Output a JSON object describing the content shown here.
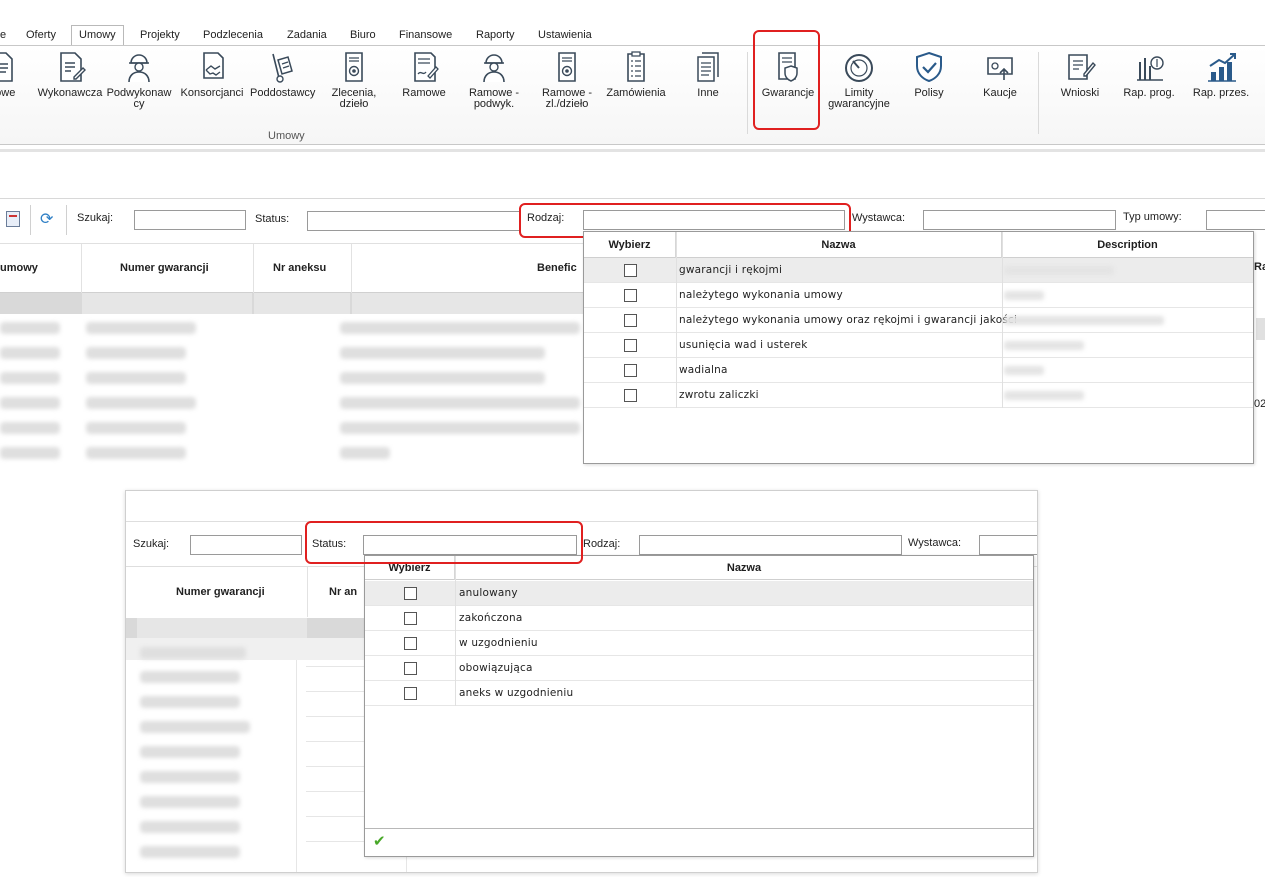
{
  "ribbon": {
    "tabs": [
      {
        "label": "e",
        "active": false
      },
      {
        "label": "Oferty",
        "active": false
      },
      {
        "label": "Umowy",
        "active": true
      },
      {
        "label": "Projekty",
        "active": false
      },
      {
        "label": "Podzlecenia",
        "active": false
      },
      {
        "label": "Zadania",
        "active": false
      },
      {
        "label": "Biuro",
        "active": false
      },
      {
        "label": "Finansowe",
        "active": false
      },
      {
        "label": "Raporty",
        "active": false
      },
      {
        "label": "Ustawienia",
        "active": false
      }
    ],
    "buttons": [
      {
        "label1": "ktowe",
        "label2": "",
        "icon": "document-icon"
      },
      {
        "label1": "Wykonawcza",
        "label2": "",
        "icon": "contract-pen-icon"
      },
      {
        "label1": "Podwykonaw",
        "label2": "cy",
        "icon": "worker-icon"
      },
      {
        "label1": "Konsorcjanci",
        "label2": "",
        "icon": "handshake-icon"
      },
      {
        "label1": "Poddostawcy",
        "label2": "",
        "icon": "hand-truck-icon"
      },
      {
        "label1": "Zlecenia,",
        "label2": "dzieło",
        "icon": "certificate-icon"
      },
      {
        "label1": "Ramowe",
        "label2": "",
        "icon": "document-sign-icon"
      },
      {
        "label1": "Ramowe -",
        "label2": "podwyk.",
        "icon": "worker-icon"
      },
      {
        "label1": "Ramowe -",
        "label2": "zl./dzieło",
        "icon": "certificate-icon"
      },
      {
        "label1": "Zamówienia",
        "label2": "",
        "icon": "checklist-icon"
      },
      {
        "label1": "Inne",
        "label2": "",
        "icon": "documents-stack-icon"
      },
      {
        "label1": "Gwarancje",
        "label2": "",
        "icon": "guarantee-shield-icon"
      },
      {
        "label1": "Limity",
        "label2": "gwarancyjne",
        "icon": "gauge-icon"
      },
      {
        "label1": "Polisy",
        "label2": "",
        "icon": "shield-check-icon"
      },
      {
        "label1": "Kaucje",
        "label2": "",
        "icon": "deposit-icon"
      },
      {
        "label1": "Wnioski",
        "label2": "",
        "icon": "edit-document-icon"
      },
      {
        "label1": "Rap. prog.",
        "label2": "",
        "icon": "report-money-icon"
      },
      {
        "label1": "Rap. przes.",
        "label2": "",
        "icon": "chart-growth-icon"
      }
    ],
    "group_label": "Umowy"
  },
  "panel1": {
    "search_label": "Szukaj:",
    "status_label": "Status:",
    "rodzaj_label": "Rodzaj:",
    "wystawca_label": "Wystawca:",
    "typ_umowy_label": "Typ umowy:",
    "columns": [
      "umowy",
      "Numer gwarancji",
      "Nr aneksu",
      "Benefic"
    ],
    "right_cut_header": "Ra",
    "right_cut_value": "02",
    "dropdown": {
      "col_select": "Wybierz",
      "col_name": "Nazwa",
      "col_desc": "Description",
      "rows": [
        {
          "name": "gwarancji i rękojmi"
        },
        {
          "name": "należytego wykonania umowy"
        },
        {
          "name": "należytego wykonania umowy oraz rękojmi i gwarancji jakości"
        },
        {
          "name": "usunięcia wad i usterek"
        },
        {
          "name": "wadialna"
        },
        {
          "name": "zwrotu zaliczki"
        }
      ]
    }
  },
  "panel2": {
    "search_label": "Szukaj:",
    "status_label": "Status:",
    "rodzaj_label": "Rodzaj:",
    "wystawca_label": "Wystawca:",
    "col_numer": "Numer gwarancji",
    "col_nr_cut": "Nr an",
    "dropdown": {
      "col_select": "Wybierz",
      "col_name": "Nazwa",
      "rows": [
        {
          "name": "anulowany"
        },
        {
          "name": "zakończona"
        },
        {
          "name": "w uzgodnieniu"
        },
        {
          "name": "obowiązująca"
        },
        {
          "name": "aneks w uzgodnieniu"
        }
      ],
      "confirm_icon": "checkmark-icon"
    }
  },
  "colors": {
    "highlight": "#e02020",
    "filter_row": "#d9d9d9",
    "confirm": "#48a828",
    "icon_stroke": "#3a4a5a"
  }
}
